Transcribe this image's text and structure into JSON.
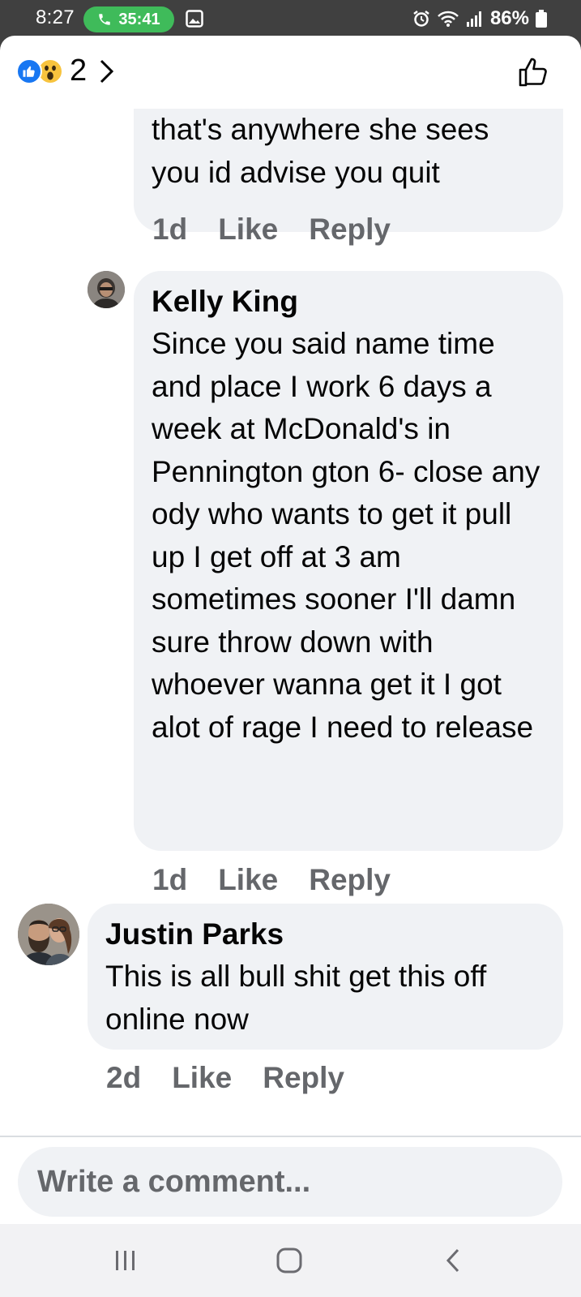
{
  "status_bar": {
    "time": "8:27",
    "call_timer": "35:41",
    "battery": "86%"
  },
  "header": {
    "reaction_count": "2",
    "reactions": [
      "like-icon",
      "wow-icon"
    ]
  },
  "comments": [
    {
      "author": "",
      "text": "that's anywhere she sees you id advise you quit",
      "time": "1d",
      "like_label": "Like",
      "reply_label": "Reply"
    },
    {
      "author": "Kelly King",
      "text": "Since you said name time and place I work 6 days a week at McDonald's in Pennington gton 6- close any ody who wants to get it pull up I get off at 3 am sometimes sooner I'll damn sure throw down with whoever wanna get it I got alot of rage I need to release",
      "time": "1d",
      "like_label": "Like",
      "reply_label": "Reply"
    },
    {
      "author": "Justin Parks",
      "text": "This is all bull shit get this off online now",
      "time": "2d",
      "like_label": "Like",
      "reply_label": "Reply"
    }
  ],
  "composer": {
    "placeholder": "Write a comment..."
  },
  "colors": {
    "like_blue": "#1877f2",
    "bubble_bg": "#f0f2f5",
    "secondary_text": "#65676b",
    "call_green": "#3fbb5a"
  }
}
